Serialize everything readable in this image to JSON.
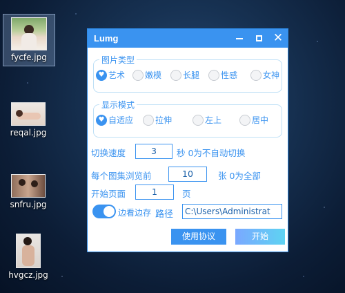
{
  "desktop": {
    "icons": [
      {
        "label": "fycfe.jpg"
      },
      {
        "label": "reqal.jpg"
      },
      {
        "label": "snfru.jpg"
      },
      {
        "label": "hvgcz.jpg"
      }
    ]
  },
  "window": {
    "title": "Lumg",
    "image_type": {
      "legend": "图片类型",
      "options": [
        "艺术",
        "嫩模",
        "长腿",
        "性感",
        "女神"
      ],
      "selected": "艺术"
    },
    "display_mode": {
      "legend": "显示模式",
      "options": [
        "自适应",
        "拉伸",
        "左上",
        "居中"
      ],
      "selected": "自适应"
    },
    "switch_speed": {
      "label": "切换速度",
      "value": "3",
      "suffix": "秒 0为不自动切换"
    },
    "per_album": {
      "label": "每个图集浏览前",
      "value": "10",
      "suffix": "张 0为全部"
    },
    "start_page": {
      "label": "开始页面",
      "value": "1",
      "suffix": "页"
    },
    "browse_save": {
      "label": "边看边存",
      "on": true
    },
    "path": {
      "label": "路径",
      "value": "C:\\Users\\Administrat"
    },
    "buttons": {
      "agreement": "使用协议",
      "start": "开始"
    }
  },
  "colors": {
    "accent": "#3a93f0",
    "desktop_bg": "#173253"
  }
}
